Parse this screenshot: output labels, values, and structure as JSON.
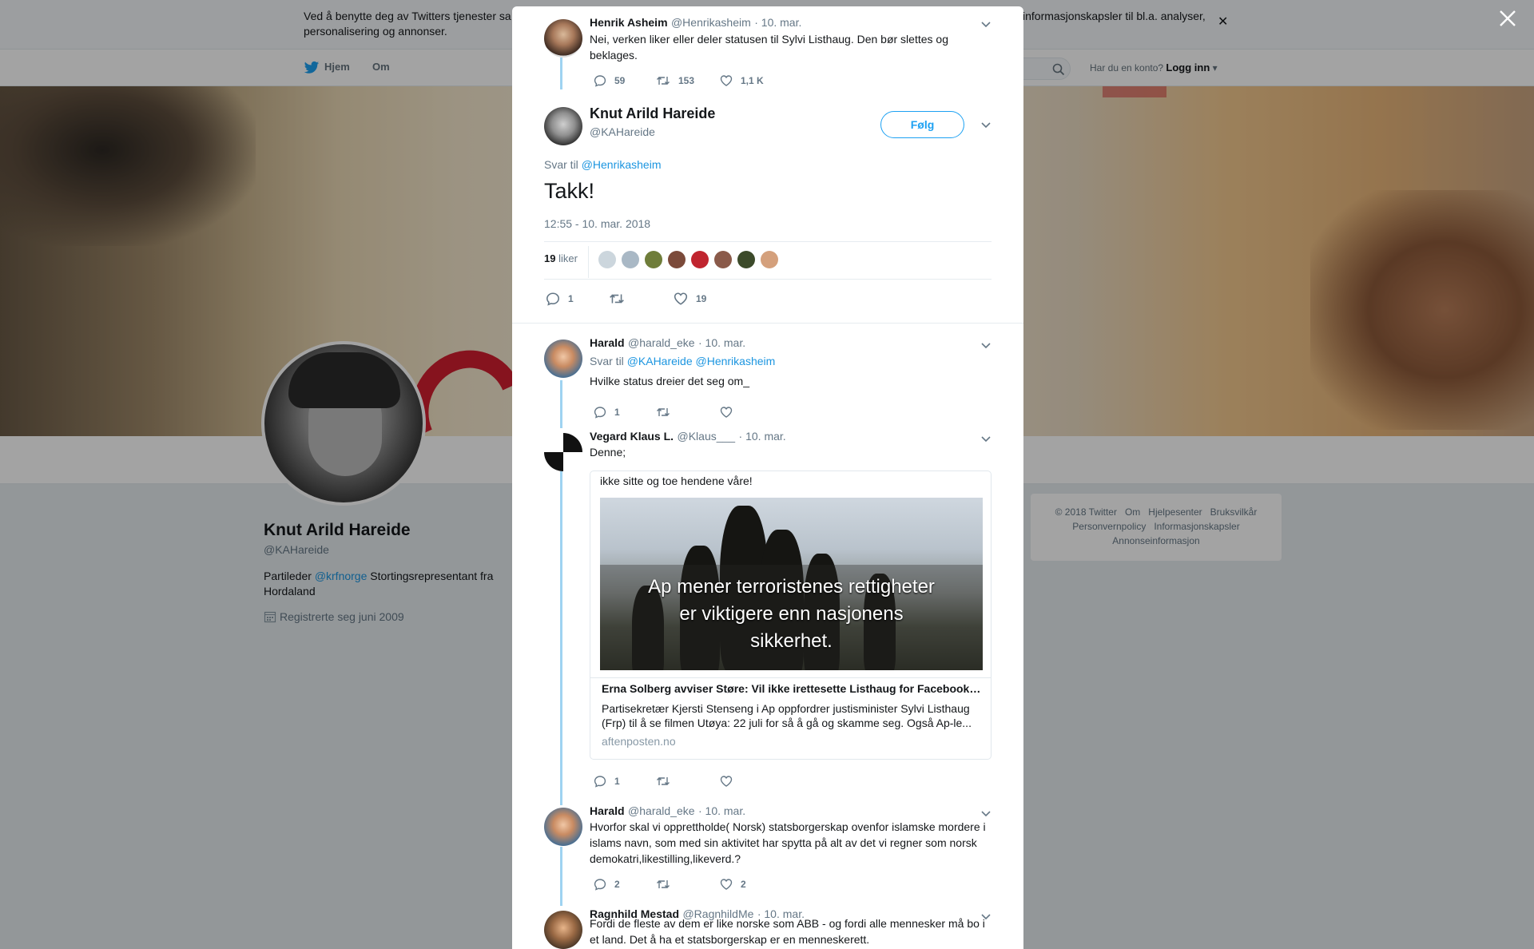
{
  "cookie_banner": {
    "text_left": "Ved å benytte deg av Twitters tjenester sa",
    "text_right": "informasjonskapsler til bl.a. analyser,",
    "text_line2": "personalisering og annonser."
  },
  "nav": {
    "home": "Hjem",
    "about": "Om",
    "have_account": "Har du en konto?",
    "login": "Logg inn"
  },
  "profile": {
    "name": "Knut Arild Hareide",
    "handle": "@KAHareide",
    "bio_prefix": "Partileder ",
    "bio_link": "@krfnorge",
    "bio_suffix": " Stortingsrepresentant fra Hordaland",
    "joined": "Registrerte seg juni 2009"
  },
  "footer": {
    "links_row1": [
      "© 2018 Twitter",
      "Om",
      "Hjelpesenter",
      "Bruksvilkår"
    ],
    "links_row2": [
      "Personvernpolicy",
      "Informasjonskapsler"
    ],
    "links_row3": [
      "Annonseinformasjon"
    ]
  },
  "parent_tweet": {
    "name": "Henrik Asheim",
    "handle": "@Henrikasheim",
    "date": "· 10. mar.",
    "text": "Nei, verken liker eller deler statusen til Sylvi Listhaug. Den bør slettes og beklages.",
    "replies": "59",
    "retweets": "153",
    "likes": "1,1 K"
  },
  "main_tweet": {
    "name": "Knut Arild Hareide",
    "handle": "@KAHareide",
    "follow": "Følg",
    "reply_to_label": "Svar til",
    "reply_to": "@Henrikasheim",
    "text": "Takk!",
    "timestamp": "12:55 - 10. mar. 2018",
    "likes_count": "19",
    "likes_label": "liker",
    "replies": "1",
    "likes": "19"
  },
  "replies": [
    {
      "name": "Harald",
      "handle": "@harald_eke",
      "date": "· 10. mar.",
      "reply_to_label": "Svar til",
      "reply_to_1": "@KAHareide",
      "reply_to_2": "@Henrikasheim",
      "text": "Hvilke status dreier det seg om_",
      "replies": "1"
    },
    {
      "name": "Vegard Klaus L.",
      "handle": "@Klaus___",
      "date": "· 10. mar.",
      "text": "Denne;",
      "card": {
        "top_text": "ikke sitte og toe hendene våre!",
        "image_caption": [
          "Ap mener terroristenes rettigheter",
          "er viktigere enn nasjonens",
          "sikkerhet."
        ],
        "title": "Erna Solberg avviser Støre: Vil ikke irettesette Listhaug for Facebook-innlegg",
        "description": "Partisekretær Kjersti Stenseng i Ap oppfordrer justisminister Sylvi Listhaug (Frp) til å se filmen Utøya: 22 juli for så å gå og skamme seg. Også Ap-le...",
        "host": "aftenposten.no"
      },
      "replies": "1"
    },
    {
      "name": "Harald",
      "handle": "@harald_eke",
      "date": "· 10. mar.",
      "text": "Hvorfor skal vi opprettholde( Norsk) statsborgerskap ovenfor islamske mordere i islams navn, som med sin aktivitet har spytta på alt av det vi regner som norsk demokatri,likestilling,likeverd.?",
      "replies": "2",
      "likes": "2"
    },
    {
      "name": "Ragnhild Mestad",
      "handle": "@RagnhildMe",
      "date": "· 10. mar.",
      "text": "Fordi de fleste av dem er like norske som ABB - og fordi alle mennesker må bo i et land. Det å ha et statsborgerskap er en menneskerett."
    }
  ],
  "colors": {
    "accent": "#1da1f2",
    "link": "#1b95e0",
    "thread_line": "#9fd3f1",
    "overlay": "rgba(0,0,0,0.36)"
  },
  "icons": [
    "twitter-bird-icon",
    "search-icon",
    "close-icon",
    "chevron-down-icon",
    "reply-icon",
    "retweet-icon",
    "heart-icon",
    "calendar-icon"
  ]
}
